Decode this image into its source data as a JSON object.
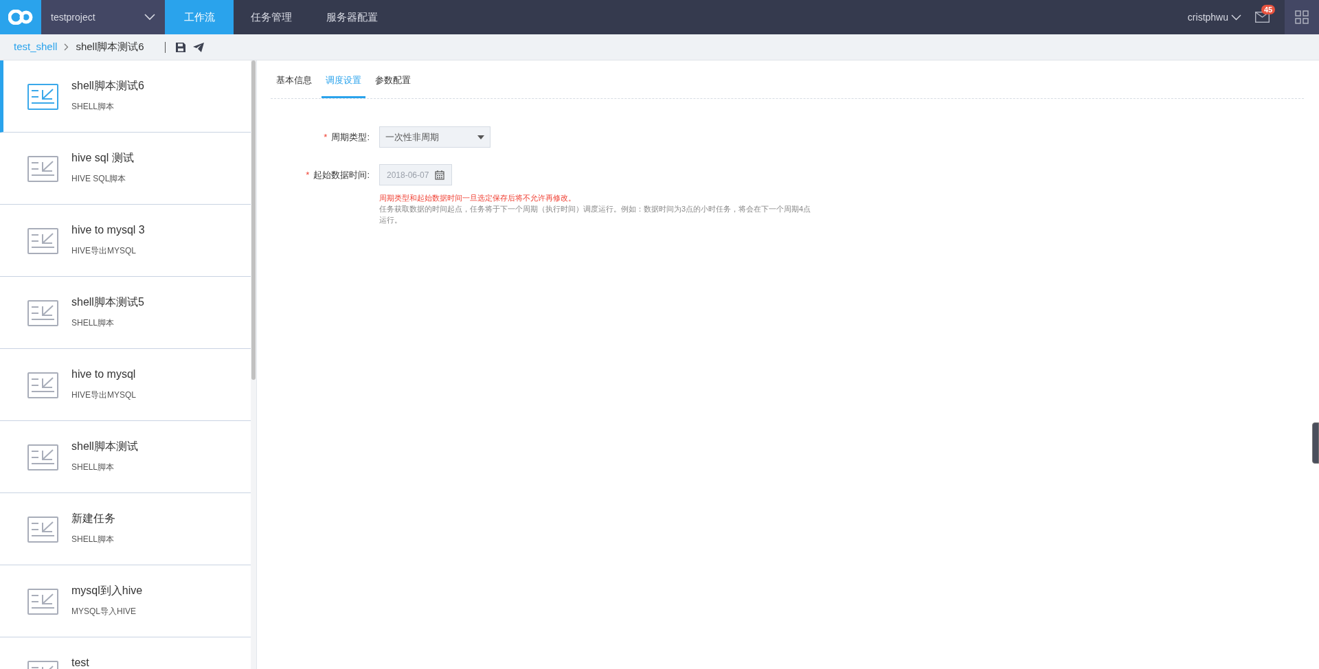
{
  "topbar": {
    "project": "testproject",
    "nav": [
      {
        "label": "工作流",
        "selected": true
      },
      {
        "label": "任务管理",
        "selected": false
      },
      {
        "label": "服务器配置",
        "selected": false
      }
    ],
    "user": "cristphwu",
    "mail_count": "45"
  },
  "breadcrumb": {
    "parent": "test_shell",
    "current": "shell脚本测试6"
  },
  "sidebar": {
    "items": [
      {
        "title": "shell脚本测试6",
        "subtitle": "SHELL脚本",
        "selected": true
      },
      {
        "title": "hive sql 测试",
        "subtitle": "HIVE SQL脚本",
        "selected": false
      },
      {
        "title": "hive to mysql 3",
        "subtitle": "HIVE导出MYSQL",
        "selected": false
      },
      {
        "title": "shell脚本测试5",
        "subtitle": "SHELL脚本",
        "selected": false
      },
      {
        "title": "hive to mysql",
        "subtitle": "HIVE导出MYSQL",
        "selected": false
      },
      {
        "title": "shell脚本测试",
        "subtitle": "SHELL脚本",
        "selected": false
      },
      {
        "title": "新建任务",
        "subtitle": "SHELL脚本",
        "selected": false
      },
      {
        "title": "mysql到入hive",
        "subtitle": "MYSQL导入HIVE",
        "selected": false
      },
      {
        "title": "test",
        "selected": false
      }
    ]
  },
  "tabs": [
    {
      "label": "基本信息",
      "selected": false
    },
    {
      "label": "调度设置",
      "selected": true
    },
    {
      "label": "参数配置",
      "selected": false
    }
  ],
  "form": {
    "fields": [
      {
        "kind": "select",
        "label": "周期类型:",
        "required_mark": "*",
        "value": "一次性非周期"
      },
      {
        "kind": "date",
        "label": "起始数据时间:",
        "required_mark": "*",
        "value": "2018-06-07",
        "disabled": true
      }
    ],
    "warning": "周期类型和起始数据时间一旦选定保存后将不允许再修改。",
    "help": "任务获取数据的时间起点，任务将于下一个周期（执行时间）调度运行。例如：数据时间为3点的小时任务，将会在下一个周期4点运行。"
  }
}
